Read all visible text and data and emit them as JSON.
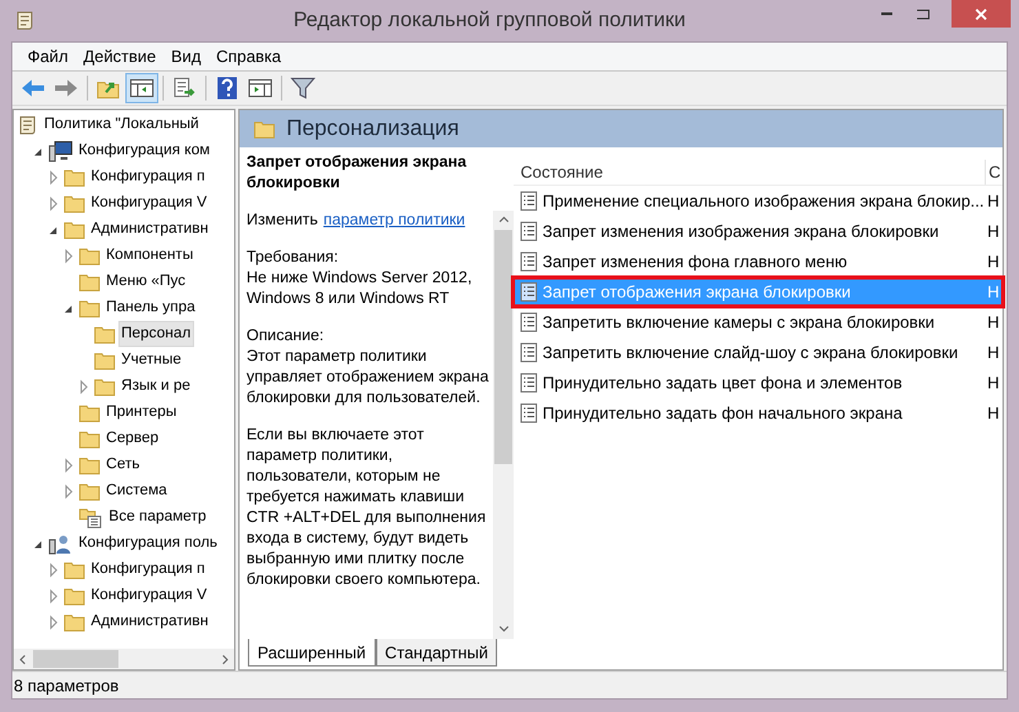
{
  "window": {
    "title": "Редактор локальной групповой политики"
  },
  "menu": [
    "Файл",
    "Действие",
    "Вид",
    "Справка"
  ],
  "toolbar": [
    [
      {
        "kind": "back",
        "pressed": false
      },
      {
        "kind": "forward",
        "pressed": false
      }
    ],
    [
      {
        "kind": "folder-up",
        "pressed": false
      },
      {
        "kind": "tree-toggle",
        "pressed": true
      }
    ],
    [
      {
        "kind": "export",
        "pressed": false
      }
    ],
    [
      {
        "kind": "help",
        "pressed": false
      },
      {
        "kind": "view",
        "pressed": false
      }
    ],
    [
      {
        "kind": "filter",
        "pressed": false
      }
    ]
  ],
  "tree": [
    {
      "label": "Политика \"Локальный",
      "kind": "root",
      "selected": false,
      "children": [
        {
          "label": "Конфигурация ком",
          "kind": "computer",
          "expanded": true,
          "selected": false,
          "children": [
            {
              "label": "Конфигурация п",
              "kind": "folder",
              "expanded": false,
              "selected": false
            },
            {
              "label": "Конфигурация V",
              "kind": "folder",
              "expanded": false,
              "selected": false
            },
            {
              "label": "Административн",
              "kind": "folder",
              "expanded": true,
              "selected": false,
              "children": [
                {
                  "label": "Компоненты",
                  "kind": "folder",
                  "expanded": false,
                  "selected": false
                },
                {
                  "label": "Меню «Пус",
                  "kind": "folder",
                  "selected": false
                },
                {
                  "label": "Панель упра",
                  "kind": "folder",
                  "expanded": true,
                  "selected": false,
                  "children": [
                    {
                      "label": "Персонал",
                      "kind": "folder",
                      "selected": true
                    },
                    {
                      "label": "Учетные",
                      "kind": "folder",
                      "selected": false
                    },
                    {
                      "label": "Язык и ре",
                      "kind": "folder",
                      "expanded": false,
                      "selected": false
                    }
                  ]
                },
                {
                  "label": "Принтеры",
                  "kind": "folder",
                  "selected": false
                },
                {
                  "label": "Сервер",
                  "kind": "folder",
                  "selected": false
                },
                {
                  "label": "Сеть",
                  "kind": "folder",
                  "expanded": false,
                  "selected": false
                },
                {
                  "label": "Система",
                  "kind": "folder",
                  "expanded": false,
                  "selected": false
                },
                {
                  "label": "Все параметр",
                  "kind": "settings",
                  "selected": false
                }
              ]
            }
          ]
        },
        {
          "label": "Конфигурация поль",
          "kind": "user",
          "expanded": true,
          "selected": false,
          "children": [
            {
              "label": "Конфигурация п",
              "kind": "folder",
              "expanded": false,
              "selected": false
            },
            {
              "label": "Конфигурация V",
              "kind": "folder",
              "expanded": false,
              "selected": false
            },
            {
              "label": "Административн",
              "kind": "folder",
              "expanded": false,
              "selected": false
            }
          ]
        }
      ]
    }
  ],
  "header": "Персонализация",
  "description": {
    "title": "Запрет отображения экрана блокировки",
    "edit_prefix": "Изменить",
    "edit_link": "параметр политики",
    "requirements_label": "Требования:",
    "requirements": "Не ниже Windows Server 2012, Windows 8 или Windows RT",
    "description_label": "Описание:",
    "paragraphs": [
      "Этот параметр политики управляет отображением экрана блокировки для пользователей.",
      "Если вы включаете этот параметр политики, пользователи, которым не требуется нажимать клавиши CTR +ALT+DEL для выполнения входа в систему, будут видеть выбранную ими плитку после блокировки своего компьютера."
    ]
  },
  "table": {
    "columns": [
      "Состояние",
      "С"
    ],
    "rows": [
      {
        "name": "Применение специального изображения экрана блокир...",
        "column_2": "Н",
        "selected": false,
        "annotated": false
      },
      {
        "name": "Запрет изменения изображения экрана блокировки",
        "column_2": "Н",
        "selected": false,
        "annotated": false
      },
      {
        "name": "Запрет изменения фона главного меню",
        "column_2": "Н",
        "selected": false,
        "annotated": false
      },
      {
        "name": "Запрет отображения экрана блокировки",
        "column_2": "Н",
        "selected": true,
        "annotated": true
      },
      {
        "name": "Запретить включение камеры с экрана блокировки",
        "column_2": "Н",
        "selected": false,
        "annotated": false
      },
      {
        "name": "Запретить включение слайд-шоу с экрана блокировки",
        "column_2": "Н",
        "selected": false,
        "annotated": false
      },
      {
        "name": "Принудительно задать цвет фона и элементов",
        "column_2": "Н",
        "selected": false,
        "annotated": false
      },
      {
        "name": "Принудительно задать фон начального экрана",
        "column_2": "Н",
        "selected": false,
        "annotated": false
      }
    ]
  },
  "tabs": [
    {
      "label": "Расширенный",
      "selected": true
    },
    {
      "label": "Стандартный",
      "selected": false
    }
  ],
  "status_bar": "8 параметров"
}
